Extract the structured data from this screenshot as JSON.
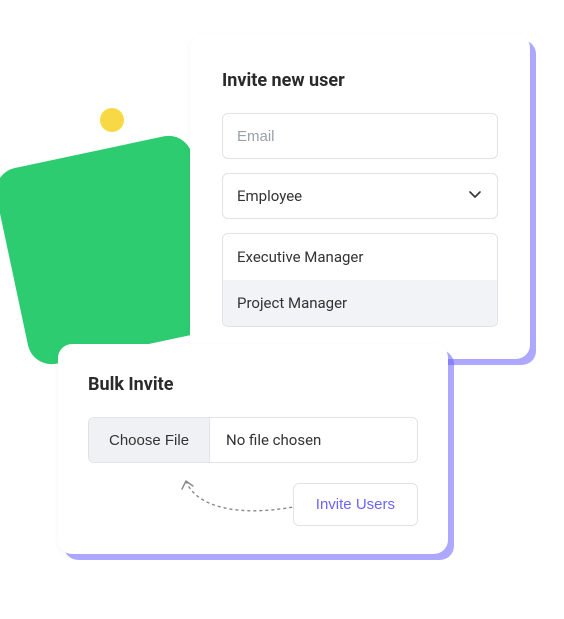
{
  "inviteCard": {
    "title": "Invite new user",
    "emailPlaceholder": "Email",
    "roleSelected": "Employee",
    "roleOptions": [
      {
        "label": "Executive Manager",
        "highlighted": false
      },
      {
        "label": "Project Manager",
        "highlighted": true
      }
    ]
  },
  "bulkCard": {
    "title": "Bulk Invite",
    "chooseFileLabel": "Choose File",
    "fileStatus": "No file chosen",
    "inviteButton": "Invite Users"
  }
}
